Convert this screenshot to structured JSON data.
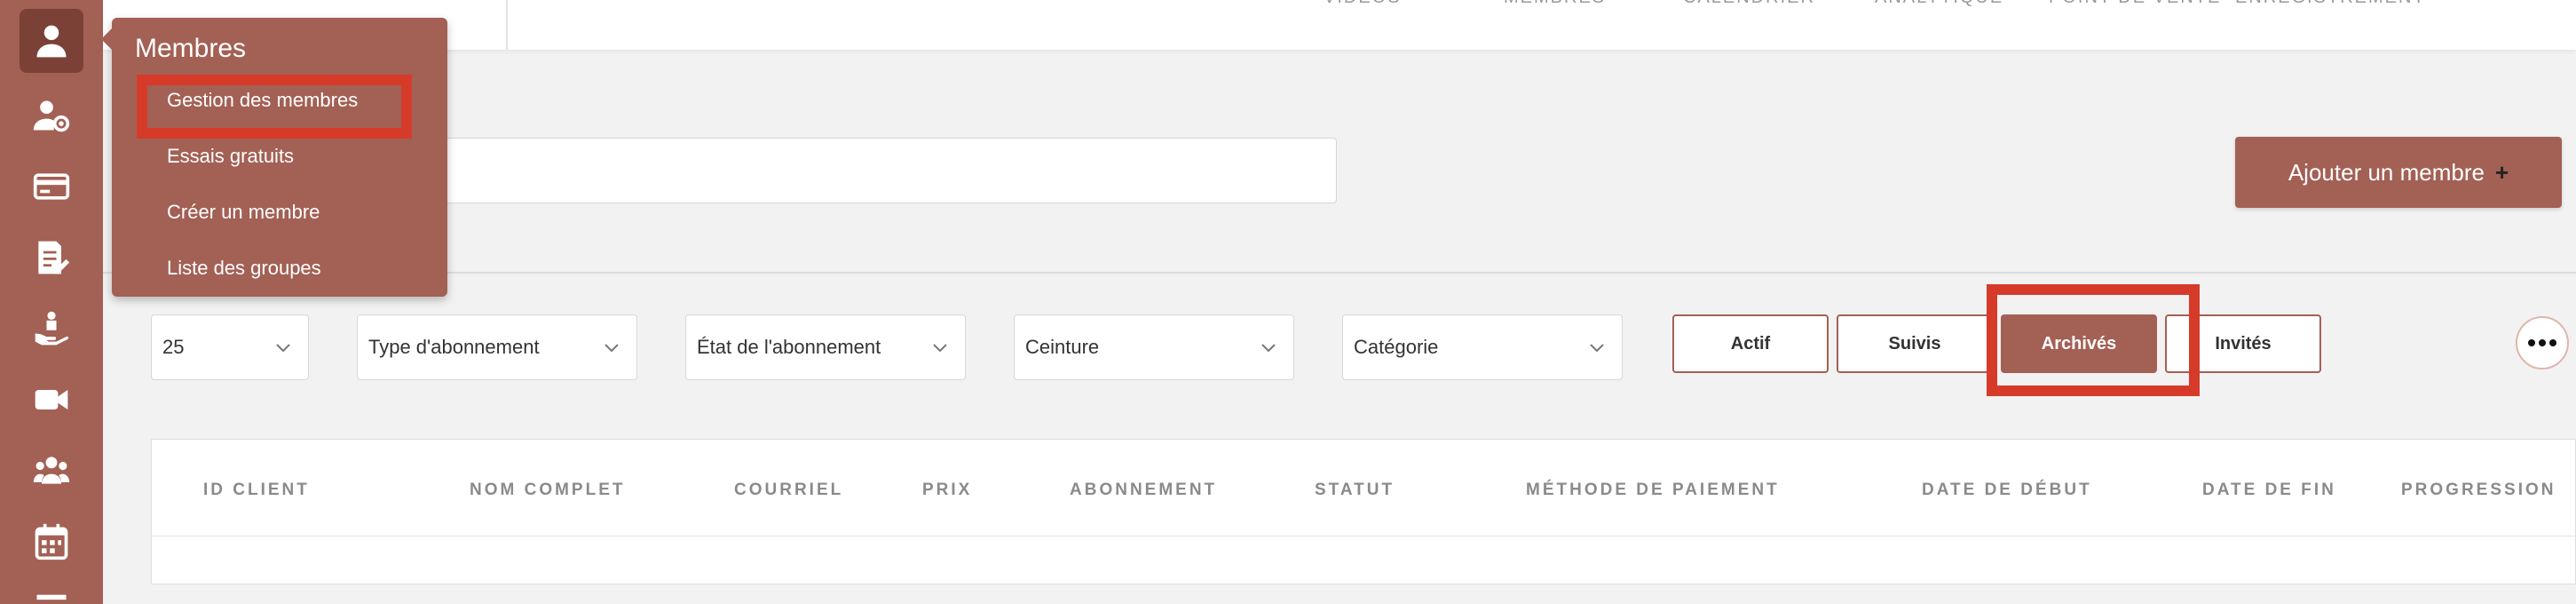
{
  "top_nav": [
    "VIDÉOS",
    "MEMBRES",
    "CALENDRIER",
    "ANALYTIQUE",
    "POINT DE VENTE",
    "ENREGISTREMENT"
  ],
  "sidebar": {
    "icons": [
      "user-icon",
      "user-settings-icon",
      "credit-card-icon",
      "document-edit-icon",
      "hand-person-icon",
      "video-camera-icon",
      "group-icon",
      "calendar-icon"
    ]
  },
  "menu": {
    "title": "Membres",
    "items": [
      "Gestion des membres",
      "Essais gratuits",
      "Créer un membre",
      "Liste des groupes"
    ]
  },
  "search": {
    "value": "",
    "placeholder": ""
  },
  "add_button": {
    "label": "Ajouter un membre",
    "icon": "+"
  },
  "filters": {
    "page_size": "25",
    "subscription_type": "Type d'abonnement",
    "subscription_state": "État de l'abonnement",
    "belt": "Ceinture",
    "category": "Catégorie"
  },
  "status_tabs": [
    "Actif",
    "Suivis",
    "Archivés",
    "Invités"
  ],
  "active_tab": "Archivés",
  "table": {
    "columns": [
      "ID CLIENT",
      "NOM COMPLET",
      "COURRIEL",
      "PRIX",
      "ABONNEMENT",
      "STATUT",
      "MÉTHODE DE PAIEMENT",
      "DATE DE DÉBUT",
      "DATE DE FIN",
      "PROGRESSION"
    ],
    "rows": []
  },
  "colors": {
    "brand": "#a36054",
    "highlight": "#d63b2a"
  }
}
